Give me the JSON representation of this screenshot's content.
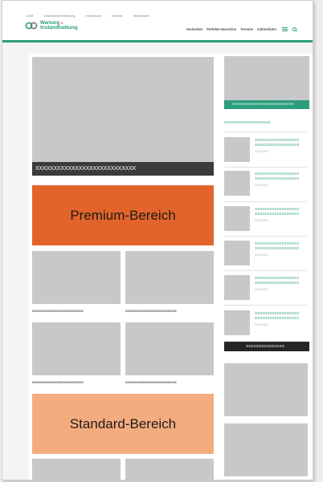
{
  "top_links": [
    "AGB",
    "Datenschutzerklärung",
    "Impressum",
    "Kontakt",
    "Mediadaten"
  ],
  "logo": {
    "line1": "Wartung",
    "amp": "&",
    "line2": "Instandhaltung"
  },
  "main_nav": [
    "Neuheiten",
    "Perfekte Maschine",
    "Termine",
    "Zahlenfutter"
  ],
  "featured": {
    "caption": "XXXXXXXXXXXXXXXXXXXXXXXXXXXX"
  },
  "premium_label": "Premium-Bereich",
  "standard_label": "Standard-Bereich",
  "grid_captions": [
    "xxxxxxxxxxxxxxxxxxxxxxxxxxxxx",
    "xxxxxxxxxxxxxxxxxxxxxxxxxxxxx",
    "xxxxxxxxxxxxxxxxxxxxxxxxxxxxx",
    "xxxxxxxxxxxxxxxxxxxxxxxxxxxxx"
  ],
  "sidebar": {
    "banner_label": "XXXXXXXXXXXXXXXXXXXXXXXX",
    "heading": "XXXXXXXXXXXXXXXXXX",
    "items": [
      {
        "line1": "XXXXXXXXXXXXXXXXXX",
        "line2": "XXXXXXXXXXXXXXXXXX",
        "sub": "XXXXXX"
      },
      {
        "line1": "XXXXXXXXXXXXXXXXXX",
        "line2": "XXXXXXXXXXXXXXXXXX",
        "sub": "XXXXXX"
      },
      {
        "line1": "XXXXXXXXXXXXXXXXXX",
        "line2": "XXXXXXXXXXXXXXXXXX",
        "sub": "XXXXXX"
      },
      {
        "line1": "XXXXXXXXXXXXXXXXXX",
        "line2": "XXXXXXXXXXXXXXXXXX",
        "sub": "XXXXXX"
      },
      {
        "line1": "XXXXXXXXXXXXXXXXXX",
        "line2": "XXXXXXXXXXXXXXXXXX",
        "sub": "XXXXXX"
      },
      {
        "line1": "XXXXXXXXXXXXXXXXXX",
        "line2": "XXXXXXXXXXXXXXXXXX",
        "sub": "XXXXXX"
      }
    ],
    "more_button": "XXXXXXXXXXXXXXX"
  },
  "colors": {
    "brand_green": "#2a9d7c",
    "premium_orange": "#e3642a",
    "standard_orange": "#f4ac7e"
  }
}
